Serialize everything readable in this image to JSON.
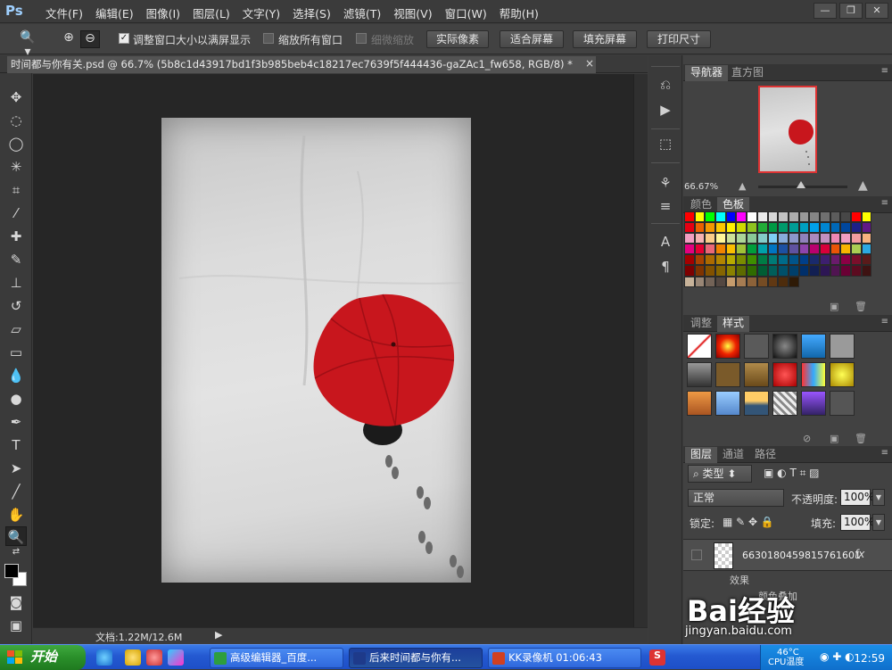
{
  "app": {
    "logo": "Ps"
  },
  "menu": [
    "文件(F)",
    "编辑(E)",
    "图像(I)",
    "图层(L)",
    "文字(Y)",
    "选择(S)",
    "滤镜(T)",
    "视图(V)",
    "窗口(W)",
    "帮助(H)"
  ],
  "window_controls": {
    "minimize": "—",
    "restore": "❐",
    "close": "✕"
  },
  "options": {
    "resize_windows_label": "调整窗口大小以满屏显示",
    "resize_windows_checked": true,
    "zoom_all_label": "缩放所有窗口",
    "zoom_all_checked": false,
    "scrubby_zoom_label": "细微缩放",
    "scrubby_zoom_checked": false,
    "buttons": {
      "actual_pixels": "实际像素",
      "fit_screen": "适合屏幕",
      "fill_screen": "填充屏幕",
      "print_size": "打印尺寸"
    }
  },
  "document": {
    "tab_title": "时间都与你有关.psd @ 66.7% (5b8c1d43917bd1f3b985beb4c18217ec7639f5f444436-gaZAc1_fw658, RGB/8) *",
    "close": "×"
  },
  "status": {
    "doc_size": "文档:1.22M/12.6M"
  },
  "panels": {
    "navigator": {
      "tabs": [
        "导航器",
        "直方图"
      ],
      "zoom": "66.67%"
    },
    "color": {
      "tabs": [
        "颜色",
        "色板"
      ],
      "swatches": [
        "#ff0000",
        "#ffff00",
        "#00ff00",
        "#00ffff",
        "#0000ff",
        "#ff00ff",
        "#ffffff",
        "#ebebeb",
        "#d6d6d6",
        "#c2c2c2",
        "#adadad",
        "#999999",
        "#858585",
        "#707070",
        "#5c5c5c",
        "#474747",
        "#ff0000",
        "#ffff00",
        "#e60012",
        "#eb6100",
        "#f39800",
        "#fcc800",
        "#fff100",
        "#cfdb00",
        "#8fc31f",
        "#22ac38",
        "#009944",
        "#009b6b",
        "#009e96",
        "#00a0c1",
        "#00a0e9",
        "#0086d1",
        "#0068b7",
        "#00479d",
        "#1d2088",
        "#601986",
        "#f19ec2",
        "#f5b2b2",
        "#facd89",
        "#fff799",
        "#cce198",
        "#acd598",
        "#89c997",
        "#84ccc9",
        "#7ecef4",
        "#88abda",
        "#8c97cb",
        "#8f82bc",
        "#aa89bd",
        "#c490bf",
        "#ee87b4",
        "#f19ec2",
        "#f29c9f",
        "#f6b37f",
        "#e4007f",
        "#e60033",
        "#eb6877",
        "#f08300",
        "#fabe00",
        "#a0c238",
        "#009e3b",
        "#00a1a9",
        "#0075c2",
        "#1d50a2",
        "#5f52a0",
        "#8e44ad",
        "#b9006e",
        "#d7003a",
        "#ea5506",
        "#f8b500",
        "#aacf53",
        "#2ca9e1",
        "#a40000",
        "#a84200",
        "#ac6a00",
        "#b28500",
        "#b7aa00",
        "#7a8c00",
        "#3e8f00",
        "#007c45",
        "#007b76",
        "#006b8a",
        "#00548a",
        "#003f8a",
        "#1a2a6c",
        "#3d1f6f",
        "#6a1b6b",
        "#8c0045",
        "#7a0f2b",
        "#5a1a1a",
        "#7d0000",
        "#7f3300",
        "#825100",
        "#866500",
        "#8a8100",
        "#5d6b00",
        "#2f6c00",
        "#005d34",
        "#005e59",
        "#00506a",
        "#003f6a",
        "#002f6a",
        "#121f52",
        "#2d1654",
        "#501451",
        "#6a0034",
        "#5c0b20",
        "#3e1212",
        "#c7b299",
        "#998675",
        "#736357",
        "#534741",
        "#c69c6d",
        "#a67c52",
        "#8c6239",
        "#754c24",
        "#603813",
        "#4d2c0c",
        "#2e1a06"
      ]
    },
    "styles": {
      "tabs": [
        "调整",
        "样式"
      ]
    },
    "layers": {
      "tabs": [
        "图层",
        "通道",
        "路径"
      ],
      "filter_kind": "类型",
      "blend_mode": "正常",
      "opacity_label": "不透明度:",
      "opacity": "100%",
      "lock_label": "锁定:",
      "fill_label": "填充:",
      "fill": "100%",
      "layer_name": "6630180459815761601",
      "fx": "fx",
      "effects_label": "效果",
      "color_overlay_label": "颜色叠加"
    }
  },
  "watermark": {
    "brand": "Bai经验",
    "url": "jingyan.baidu.com"
  },
  "taskbar": {
    "start": "开始",
    "tasks": [
      {
        "label": "高级编辑器_百度...",
        "color": "#2e9e3e"
      },
      {
        "label": "后来时间都与你有...",
        "color": "#1e3a8a"
      },
      {
        "label": "KK录像机  01:06:43",
        "color": "#d04020"
      }
    ],
    "tray": {
      "temp": "46°C",
      "cpu_label": "CPU温度",
      "clock": "12:59"
    }
  },
  "colors": {
    "accent_red": "#c8161d",
    "panel_bg": "#424242",
    "canvas_bg": "#262626"
  }
}
